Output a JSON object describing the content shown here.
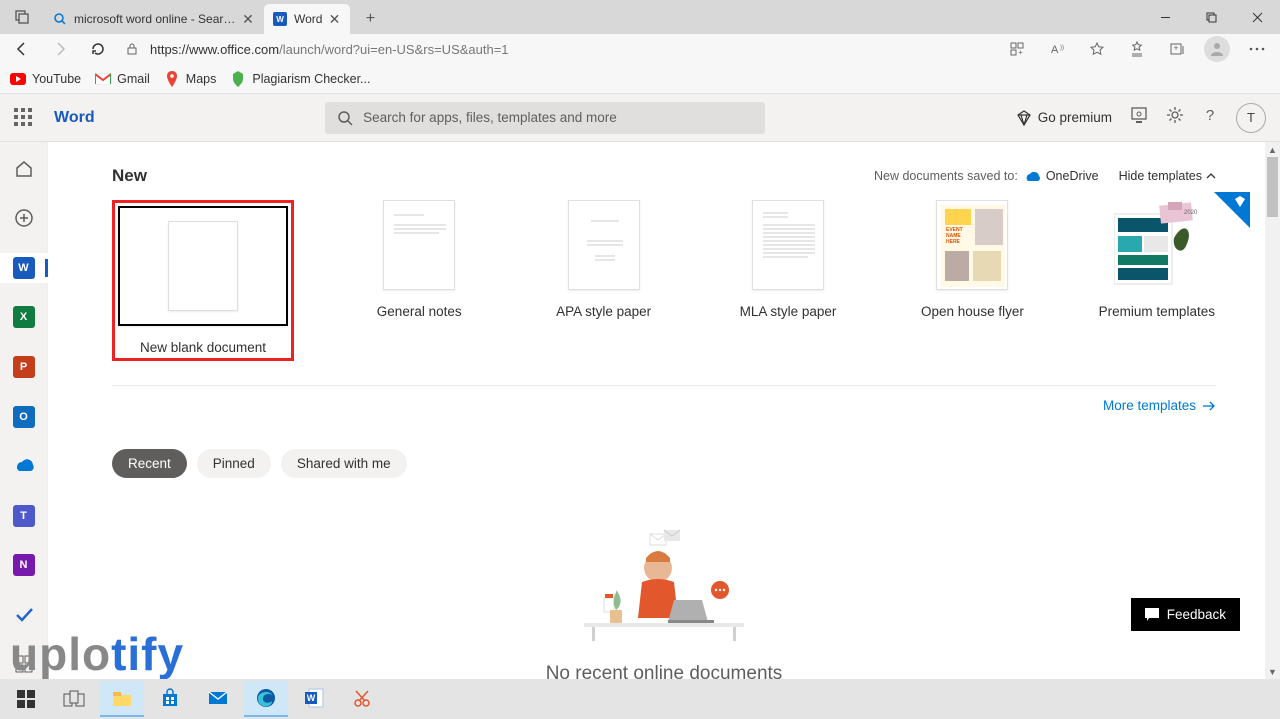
{
  "browser": {
    "tabs": [
      {
        "title": "microsoft word online - Search",
        "active": false
      },
      {
        "title": "Word",
        "active": true
      }
    ],
    "url_host": "https://www.office.com",
    "url_path": "/launch/word?ui=en-US&rs=US&auth=1",
    "bookmarks": [
      {
        "label": "YouTube"
      },
      {
        "label": "Gmail"
      },
      {
        "label": "Maps"
      },
      {
        "label": "Plagiarism Checker..."
      }
    ]
  },
  "header": {
    "app_name": "Word",
    "search_placeholder": "Search for apps, files, templates and more",
    "go_premium": "Go premium",
    "user_initial": "T"
  },
  "new_section": {
    "title": "New",
    "saved_prefix": "New documents saved to:",
    "saved_location": "OneDrive",
    "hide_templates": "Hide templates",
    "templates": [
      {
        "label": "New blank document"
      },
      {
        "label": "General notes"
      },
      {
        "label": "APA style paper"
      },
      {
        "label": "MLA style paper"
      },
      {
        "label": "Open house flyer"
      },
      {
        "label": "Premium templates"
      }
    ],
    "more_templates": "More templates"
  },
  "doc_tabs": {
    "recent": "Recent",
    "pinned": "Pinned",
    "shared": "Shared with me"
  },
  "empty_state": "No recent online documents",
  "feedback": "Feedback",
  "watermark": {
    "part1": "uplo",
    "part2": "tify"
  }
}
